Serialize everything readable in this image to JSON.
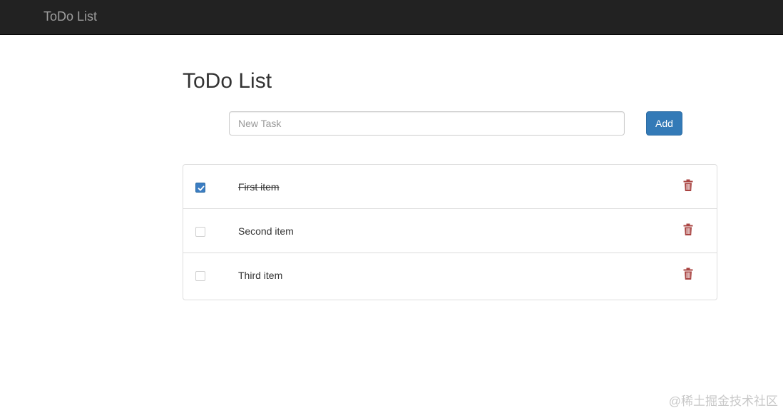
{
  "navbar": {
    "brand": "ToDo List"
  },
  "main": {
    "title": "ToDo List",
    "input": {
      "value": "",
      "placeholder": "New Task"
    },
    "add_label": "Add"
  },
  "tasks": [
    {
      "label": "First item",
      "done": true
    },
    {
      "label": "Second item",
      "done": false
    },
    {
      "label": "Third item",
      "done": false
    }
  ],
  "icons": {
    "checkbox": "check-icon",
    "delete": "trash-icon"
  },
  "colors": {
    "navbar": "#222222",
    "accent": "#337ab7",
    "trash": "#a94442"
  },
  "watermark": "@稀土掘金技术社区"
}
